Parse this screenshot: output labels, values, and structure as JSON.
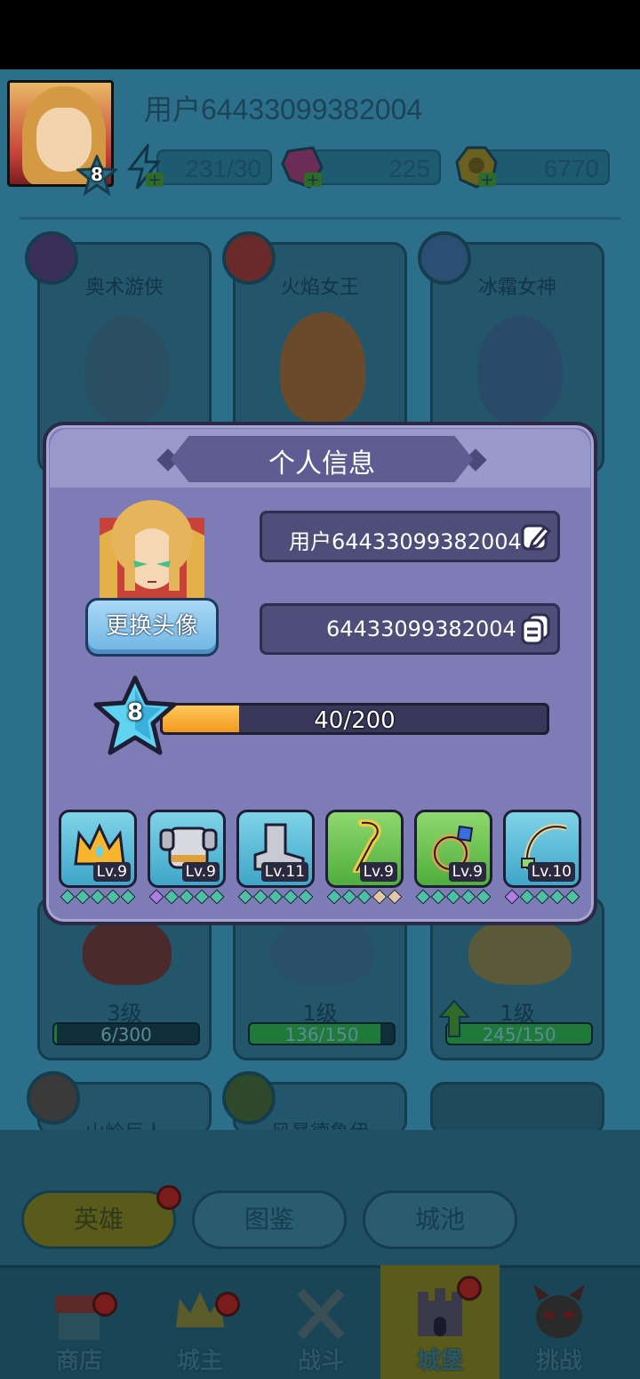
{
  "header": {
    "username": "用户64433099382004",
    "player_level": "8",
    "energy": "231/30",
    "gems": "225",
    "gold": "6770"
  },
  "hero_cards_top": [
    {
      "name": "奥术游侠"
    },
    {
      "name": "火焰女王"
    },
    {
      "name": "冰霜女神"
    }
  ],
  "hero_cards_bottom": [
    {
      "level": "3级",
      "progress": "6/300",
      "fill": 0.02
    },
    {
      "level": "1级",
      "progress": "136/150",
      "fill": 0.91
    },
    {
      "level": "1级",
      "progress": "245/150",
      "fill": 1.0
    }
  ],
  "hero_cards_third_row": [
    {
      "name": "山岭巨人"
    },
    {
      "name": "风暴德鲁伊"
    }
  ],
  "sub_tabs": [
    {
      "label": "英雄"
    },
    {
      "label": "图鉴"
    },
    {
      "label": "城池"
    }
  ],
  "nav": [
    {
      "label": "商店"
    },
    {
      "label": "城主"
    },
    {
      "label": "战斗"
    },
    {
      "label": "城堡"
    },
    {
      "label": "挑战"
    }
  ],
  "modal": {
    "title": "个人信息",
    "change_avatar_label": "更换头像",
    "name_value": "用户64433099382004",
    "id_value": "64433099382004",
    "level": "8",
    "xp_text": "40/200",
    "xp_fraction": 0.2,
    "equipment": [
      {
        "icon": "crown-icon",
        "level": "Lv.9",
        "rarity": "blue",
        "gems": [
          "#4fc0a6",
          "#4fc0a6",
          "#4fc0a6",
          "#4fc0a6",
          "#4fc0a6"
        ]
      },
      {
        "icon": "armor-icon",
        "level": "Lv.9",
        "rarity": "blue",
        "gems": [
          "#b080e0",
          "#4fc0a6",
          "#4fc0a6",
          "#4fc0a6",
          "#4fc0a6"
        ]
      },
      {
        "icon": "boots-icon",
        "level": "Lv.11",
        "rarity": "blue",
        "gems": [
          "#4fc0a6",
          "#4fc0a6",
          "#4fc0a6",
          "#4fc0a6",
          "#4fc0a6"
        ]
      },
      {
        "icon": "staff-icon",
        "level": "Lv.9",
        "rarity": "green",
        "gems": [
          "#4fc0a6",
          "#4fc0a6",
          "#4fc0a6",
          "#e0c8a8",
          "#e0c8a8"
        ]
      },
      {
        "icon": "ring-icon",
        "level": "Lv.9",
        "rarity": "green",
        "gems": [
          "#4fc0a6",
          "#4fc0a6",
          "#4fc0a6",
          "#4fc0a6",
          "#4fc0a6"
        ]
      },
      {
        "icon": "bow-icon",
        "level": "Lv.10",
        "rarity": "blue",
        "gems": [
          "#b080e0",
          "#4fc0a6",
          "#4fc0a6",
          "#4fc0a6",
          "#4fc0a6"
        ]
      }
    ]
  }
}
